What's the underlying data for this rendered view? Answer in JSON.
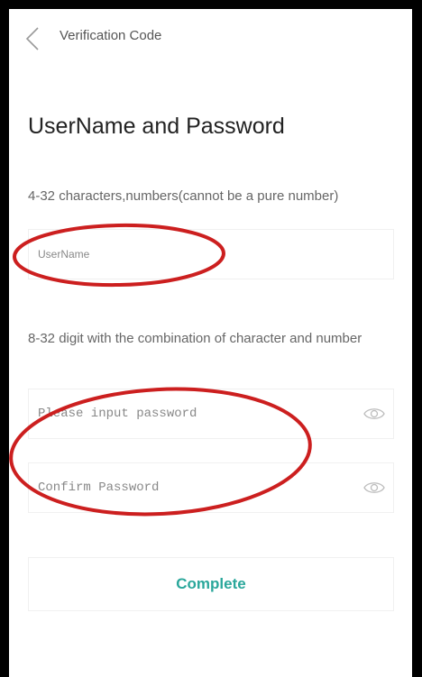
{
  "nav": {
    "back_icon": "chevron-left-icon",
    "title": "Verification Code"
  },
  "page": {
    "title": "UserName and Password"
  },
  "username": {
    "hint": "4-32 characters,numbers(cannot be a pure number)",
    "placeholder": "UserName",
    "value": ""
  },
  "password": {
    "hint": "8-32 digit with the combination of character and number",
    "placeholder": "Please input password",
    "value": "",
    "toggle_icon": "eye-icon"
  },
  "confirm_password": {
    "placeholder": "Confirm Password",
    "value": "",
    "toggle_icon": "eye-icon"
  },
  "actions": {
    "complete_label": "Complete"
  },
  "colors": {
    "accent": "#2aa79b",
    "annotation": "#cc1f1f",
    "frame": "#000000"
  }
}
